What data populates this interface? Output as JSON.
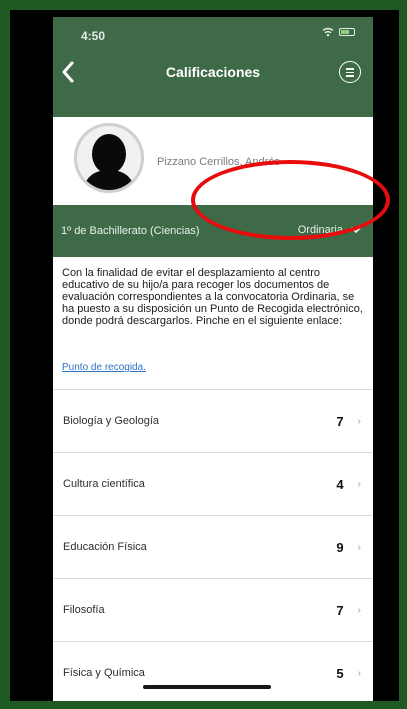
{
  "status_bar": {
    "time": "4:50"
  },
  "header": {
    "title": "Calificaciones"
  },
  "student": {
    "name": "Pizzano Cerrillos, Andrés"
  },
  "course_bar": {
    "course": "1º de Bachillerato (Ciencias)",
    "period": "Ordinaria"
  },
  "info": {
    "message": "Con la finalidad de evitar el desplazamiento al centro educativo de su hijo/a para recoger los documentos de evaluación correspondientes a la convocatoria Ordinaria, se ha puesto a su disposición un Punto de Recogida electrónico, donde podrá descargarlos. Pinche en el siguiente enlace:",
    "link_label": "Punto de recogida."
  },
  "subjects": [
    {
      "name": "Biología y Geología",
      "grade": "7"
    },
    {
      "name": "Cultura científica",
      "grade": "4"
    },
    {
      "name": "Educación Física",
      "grade": "9"
    },
    {
      "name": "Filosofía",
      "grade": "7"
    },
    {
      "name": "Física y Química",
      "grade": "5"
    }
  ],
  "colors": {
    "brand": "#3f6a48",
    "annotation": "#e80c0c",
    "link": "#2a73c5"
  }
}
